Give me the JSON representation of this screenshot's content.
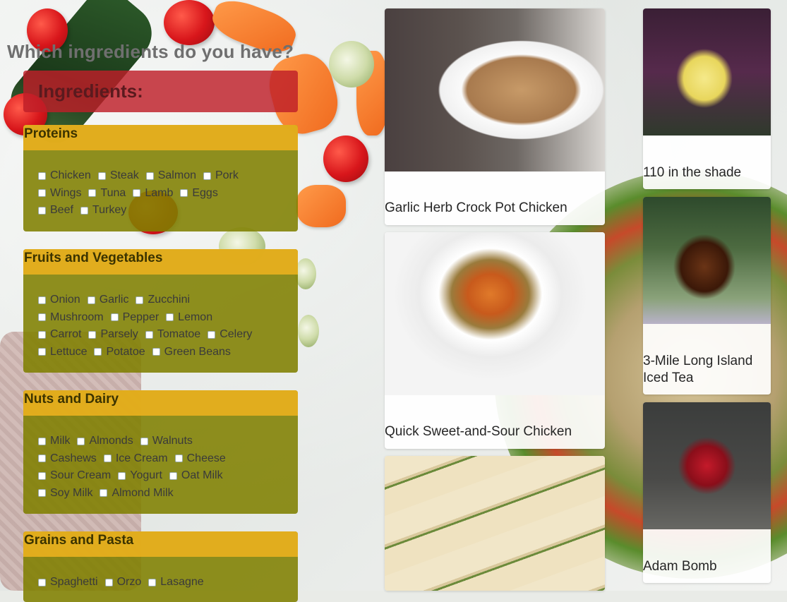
{
  "page": {
    "heading": "Which ingredients do you have?"
  },
  "ingredients_panel": {
    "title": "Ingredients:",
    "categories": [
      {
        "title": "Proteins",
        "rows": [
          [
            "Chicken",
            "Steak",
            "Salmon",
            "Pork"
          ],
          [
            "Wings",
            "Tuna",
            "Lamb",
            "Eggs"
          ],
          [
            "Beef",
            "Turkey"
          ]
        ]
      },
      {
        "title": "Fruits and Vegetables",
        "rows": [
          [
            "Onion",
            "Garlic",
            "Zucchini"
          ],
          [
            "Mushroom",
            "Pepper",
            "Lemon"
          ],
          [
            "Carrot",
            "Parsely",
            "Tomatoe",
            "Celery"
          ],
          [
            "Lettuce",
            "Potatoe",
            "Green Beans"
          ]
        ]
      },
      {
        "title": "Nuts and Dairy",
        "rows": [
          [
            "Milk",
            "Almonds",
            "Walnuts"
          ],
          [
            "Cashews",
            "Ice Cream",
            "Cheese"
          ],
          [
            "Sour Cream",
            "Yogurt",
            "Oat Milk"
          ],
          [
            "Soy Milk",
            "Almond Milk"
          ]
        ]
      },
      {
        "title": "Grains and Pasta",
        "rows": [
          [
            "Spaghetti",
            "Orzo",
            "Lasagne"
          ]
        ]
      }
    ]
  },
  "recipes": [
    {
      "title": "Garlic Herb Crock Pot Chicken",
      "image": "slow-cooked-chicken-photo"
    },
    {
      "title": "Quick Sweet-and-Sour Chicken",
      "image": "stir-fry-bowl-photo"
    },
    {
      "title": "",
      "image": "stuffed-rolls-photo"
    }
  ],
  "drinks": [
    {
      "title": "110 in the shade",
      "image": "yellow-cocktail-photo"
    },
    {
      "title": "3-Mile Long Island Iced Tea",
      "image": "iced-tea-photo"
    },
    {
      "title": "Adam Bomb",
      "image": "red-cocktail-photo"
    }
  ],
  "colors": {
    "ingredients_header": "#be1e28",
    "category_header": "#e8b01e",
    "category_body": "#808000",
    "heading_text": "#6f6f6f"
  }
}
